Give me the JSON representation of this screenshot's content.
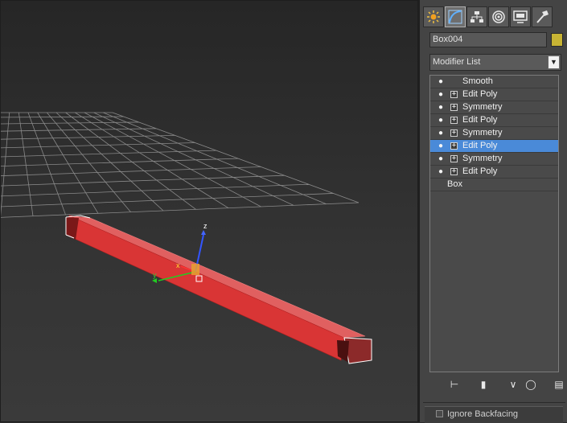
{
  "viewport": {
    "gizmo": {
      "z_label": "z",
      "x_label": "x",
      "y_label": "y"
    }
  },
  "panel": {
    "tabs": [
      {
        "name": "create-tab",
        "icon": "create-sunburst-icon",
        "active": false
      },
      {
        "name": "modify-tab",
        "icon": "modify-curve-icon",
        "active": true
      },
      {
        "name": "hierarchy-tab",
        "icon": "hierarchy-icon",
        "active": false
      },
      {
        "name": "motion-tab",
        "icon": "motion-icon",
        "active": false
      },
      {
        "name": "display-tab",
        "icon": "display-monitor-icon",
        "active": false
      },
      {
        "name": "utilities-tab",
        "icon": "utilities-hammer-icon",
        "active": false
      }
    ],
    "object_name": "Box004",
    "object_color": "#c8b434",
    "modifier_list_label": "Modifier List",
    "stack": [
      {
        "label": "Smooth",
        "expandable": false,
        "selected": false
      },
      {
        "label": "Edit Poly",
        "expandable": true,
        "selected": false
      },
      {
        "label": "Symmetry",
        "expandable": true,
        "selected": false
      },
      {
        "label": "Edit Poly",
        "expandable": true,
        "selected": false
      },
      {
        "label": "Symmetry",
        "expandable": true,
        "selected": false
      },
      {
        "label": "Edit Poly",
        "expandable": true,
        "selected": true
      },
      {
        "label": "Symmetry",
        "expandable": true,
        "selected": false
      },
      {
        "label": "Edit Poly",
        "expandable": true,
        "selected": false
      }
    ],
    "base_object": "Box",
    "selected_color": "#4a8ad8",
    "rollout_label": "Ignore Backfacing"
  }
}
